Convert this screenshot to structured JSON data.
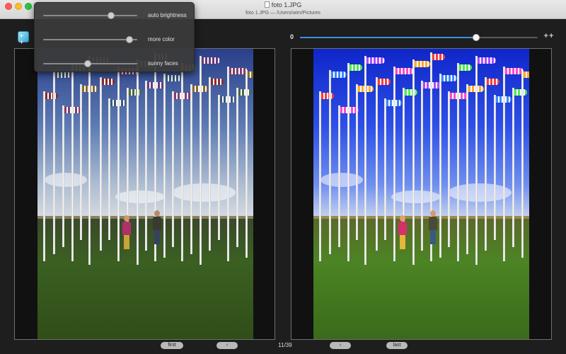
{
  "window": {
    "title": "foto 1.JPG",
    "subtitle": "foto 1.JPG  —  /Users/wim/Pictures"
  },
  "toolbar": {
    "icon": "enhance-icon",
    "strength_min_label": "0",
    "strength_max_label": "++",
    "strength_value": 0.74
  },
  "adjustments": [
    {
      "label": "auto brightness",
      "value": 0.72
    },
    {
      "label": "more color",
      "value": 0.92
    },
    {
      "label": "sunny faces",
      "value": 0.47
    }
  ],
  "navigation": {
    "first_label": "first",
    "prev_icon": "chevron-left-icon",
    "counter": "11/39",
    "next_icon": "chevron-right-icon",
    "last_label": "last"
  },
  "colors": {
    "accent": "#3d8fe6",
    "background": "#1e1e1e"
  }
}
